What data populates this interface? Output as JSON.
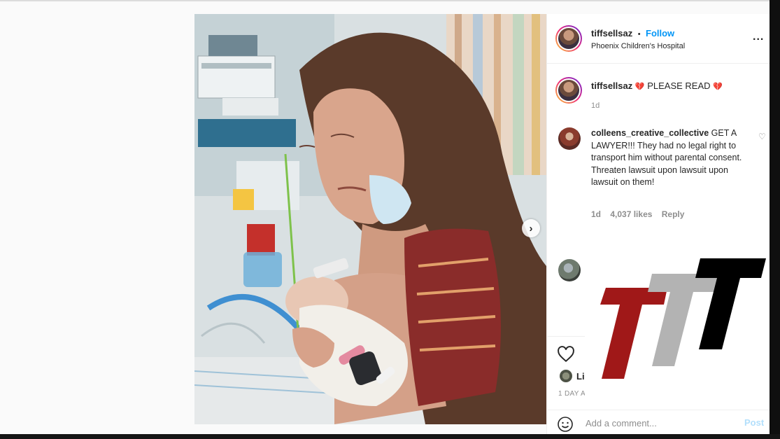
{
  "post": {
    "username": "tiffsellsaz",
    "separator": "•",
    "follow_label": "Follow",
    "location": "Phoenix Children's Hospital",
    "more_label": "...",
    "caption_user": "tiffsellsaz",
    "caption_heart1": "💔",
    "caption_text": "PLEASE READ",
    "caption_heart2": "💔",
    "caption_time": "1d"
  },
  "comments": [
    {
      "username": "colleens_creative_collective",
      "text": "GET A LAWYER!!! They had no legal right to transport him without parental consent. Threaten lawsuit upon lawsuit upon lawsuit on them!",
      "time": "1d",
      "likes": "4,037 likes",
      "reply_label": "Reply"
    }
  ],
  "actions": {
    "liked_by_partial": "Li",
    "date_partial": "1 DAY A"
  },
  "composer": {
    "placeholder": "Add a comment...",
    "post_label": "Post"
  },
  "photo": {
    "next_label": "›"
  },
  "logo": {
    "colors": [
      "#a01818",
      "#b3b3b3",
      "#000000"
    ]
  }
}
